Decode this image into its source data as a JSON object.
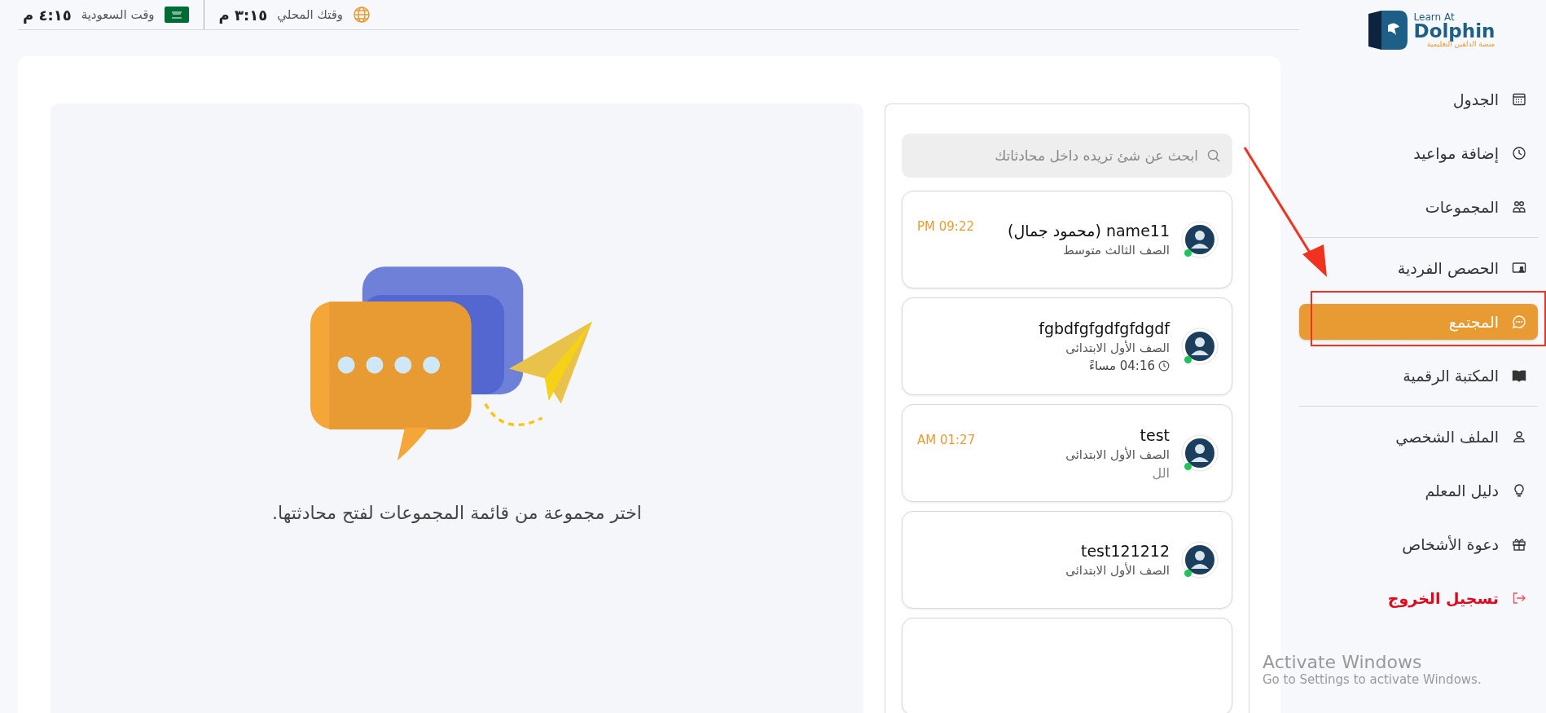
{
  "logo": {
    "title": "Learn At",
    "name": "Dolphin",
    "tagline": "منصة الدلفين التعليمية"
  },
  "topbar": {
    "clocks": [
      {
        "label": "وقتك المحلي",
        "time": "٣:١٥ م",
        "kind": "local"
      },
      {
        "label": "وقت السعودية",
        "time": "٤:١٥ م",
        "kind": "saudi"
      }
    ]
  },
  "sidebar": {
    "groups": [
      [
        {
          "label": "الجدول",
          "selected": false,
          "kind": "link"
        },
        {
          "label": "إضافة مواعيد",
          "selected": false,
          "kind": "link"
        },
        {
          "label": "المجموعات",
          "selected": false,
          "kind": "link"
        }
      ],
      [
        {
          "label": "الحصص الفردية",
          "selected": false,
          "kind": "link"
        },
        {
          "label": "المجتمع",
          "selected": true,
          "kind": "link"
        },
        {
          "label": "المكتبة الرقمية",
          "selected": false,
          "kind": "link"
        }
      ],
      [
        {
          "label": "الملف الشخصي",
          "selected": false,
          "kind": "link"
        },
        {
          "label": "دليل المعلم",
          "selected": false,
          "kind": "link"
        },
        {
          "label": "دعوة الأشخاص",
          "selected": false,
          "kind": "link"
        },
        {
          "label": "تسجيل الخروج",
          "selected": false,
          "kind": "logout"
        }
      ]
    ]
  },
  "chat": {
    "search": {
      "placeholder": "ابحث عن شئ تريده داخل محادثاتك"
    },
    "conversations": [
      {
        "name": "name11 (محمود جمال)",
        "grade": "الصف الثالث متوسط",
        "time": "PM 09:22",
        "online": true
      },
      {
        "name": "fgbdfgfgdfgfdgdf",
        "grade": "الصف الأول الابتدائى",
        "sent": "04:16 مساءً",
        "online": true
      },
      {
        "name": "test",
        "grade": "الصف الأول الابتدائى",
        "time": "AM 01:27",
        "last_message": "الل",
        "online": true
      },
      {
        "name": "test121212",
        "grade": "الصف الأول الابتدائى",
        "online": true
      }
    ]
  },
  "empty_state": {
    "message": "اختر مجموعة من قائمة المجموعات لفتح محادثتها."
  },
  "os_notice": {
    "title": "Activate Windows",
    "subtitle": "Go to Settings to activate Windows."
  }
}
